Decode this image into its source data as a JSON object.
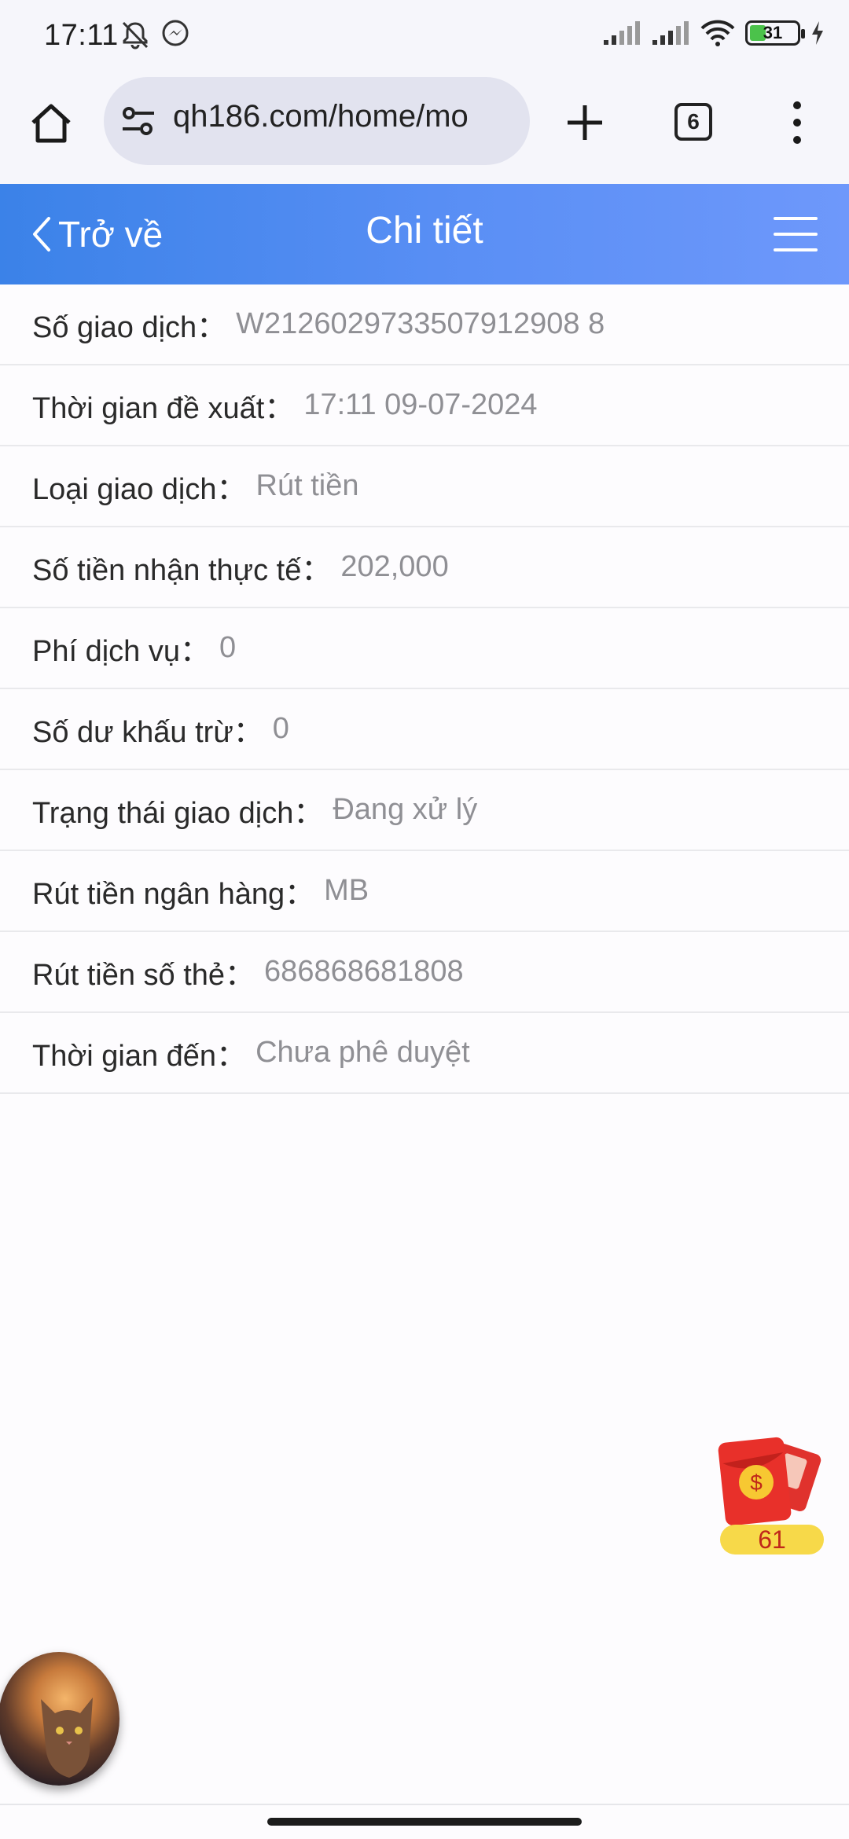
{
  "status_bar": {
    "time": "17:11",
    "battery": "31",
    "icons_left": [
      "bell-off-icon",
      "messenger-icon"
    ],
    "icons_right": [
      "signal-icon",
      "signal-icon",
      "wifi-icon",
      "battery-icon",
      "charging-icon"
    ]
  },
  "browser": {
    "url": "qh186.com/home/mo",
    "tab_count": "6"
  },
  "header": {
    "back_label": "Trở về",
    "title": "Chi tiết"
  },
  "details": [
    {
      "label": "Số giao dịch：",
      "value": "W2126029733507912908 8"
    },
    {
      "label": "Thời gian đề xuất：",
      "value": "17:11 09-07-2024"
    },
    {
      "label": "Loại giao dịch：",
      "value": "Rút tiền"
    },
    {
      "label": "Số tiền nhận thực tế：",
      "value": "202,000"
    },
    {
      "label": "Phí dịch vụ：",
      "value": "0"
    },
    {
      "label": "Số dư khấu trừ：",
      "value": "0"
    },
    {
      "label": "Trạng thái giao dịch：",
      "value": "Đang xử lý"
    },
    {
      "label": "Rút tiền ngân hàng：",
      "value": "MB"
    },
    {
      "label": "Rút tiền số thẻ：",
      "value": "686868681808"
    },
    {
      "label": "Thời gian đến：",
      "value": "Chưa phê duyệt"
    }
  ],
  "floating": {
    "envelope_count": "61"
  },
  "colors": {
    "header_start": "#3b82e8",
    "header_end": "#6e98fb",
    "value_text": "#8f8f94"
  }
}
